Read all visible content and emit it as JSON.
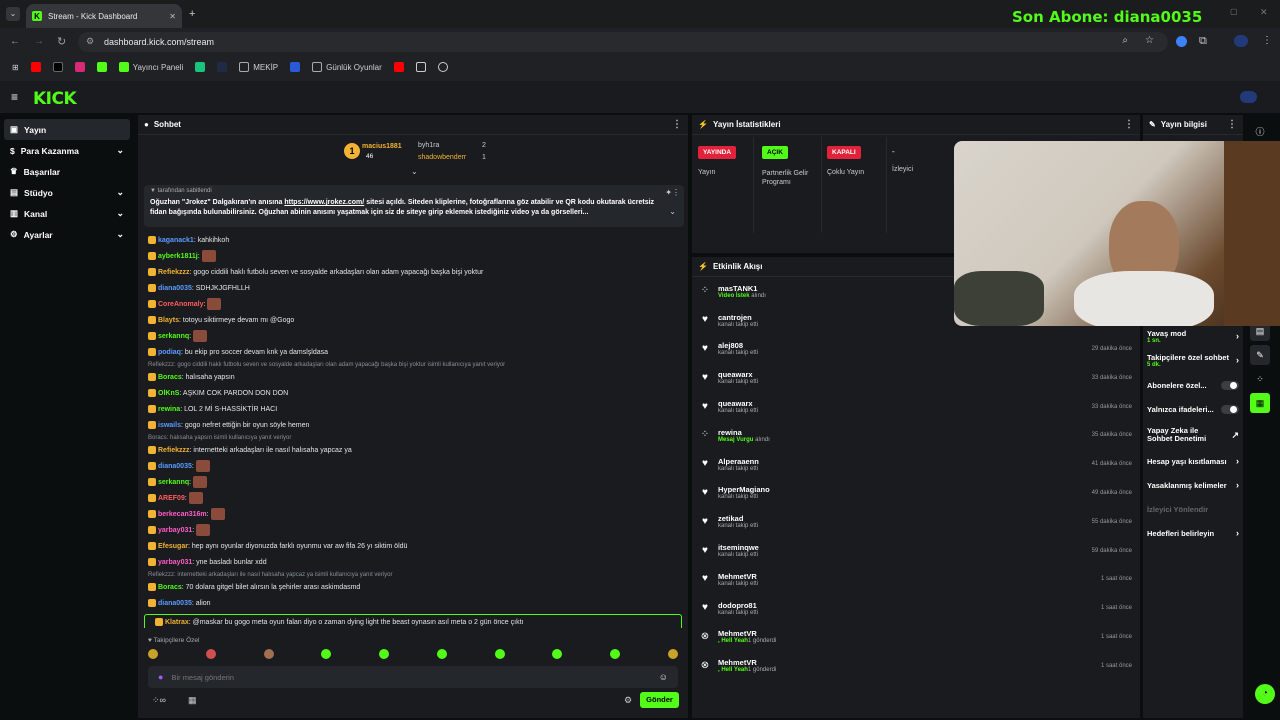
{
  "browser": {
    "tab_title": "Stream - Kick Dashboard",
    "url": "dashboard.kick.com/stream",
    "overlay_text": "Son Abone: diana0035",
    "bookmarks": [
      "Yayıncı Paneli",
      "MEKİP",
      "Günlük Oyunlar"
    ]
  },
  "sidebar": {
    "items": [
      {
        "label": "Yayın"
      },
      {
        "label": "Para Kazanma"
      },
      {
        "label": "Başarılar"
      },
      {
        "label": "Stüdyo"
      },
      {
        "label": "Kanal"
      },
      {
        "label": "Ayarlar"
      }
    ]
  },
  "chat": {
    "title": "Sohbet",
    "top_gifters": [
      {
        "name": "macius1881",
        "count": "46"
      },
      {
        "name": "byh1ra",
        "count": "2"
      },
      {
        "name": "shadowbenderr",
        "count": "1"
      }
    ],
    "pinned_by": "tarafından sabitlendi",
    "pinned_text_1": "Oğuzhan \"Jrokez\" Dalgakıran'ın anısına",
    "pinned_link": "https://www.jrokez.com/",
    "pinned_text_2": "sitesi açıldı. Siteden kliplerine, fotoğraflarına göz atabilir ve QR kodu okutarak ücretsiz fidan bağışında bulunabilirsiniz. Oğuzhan abinin anısını yaşatmak için siz de siteye girip eklemek istediğiniz video ya da görselleri...",
    "messages": [
      {
        "user": "kaganack1",
        "text": ": kahkihkoh",
        "color": "#5b9bff"
      },
      {
        "user": "ayberk1811j",
        "text": ":",
        "color": "#53fc18"
      },
      {
        "user": "Refiekzzz",
        "text": ": gogo ciddili haklı futbolu seven ve sosyalde arkadaşları olan adam yapacağı başka bişi yoktur",
        "color": "#f2b233"
      },
      {
        "user": "diana0035",
        "text": ": SDHJKJGFHLLH",
        "color": "#5b9bff"
      },
      {
        "user": "CoreAnomaly",
        "text": ":",
        "color": "#ff5c5c"
      },
      {
        "user": "Blayts",
        "text": ": totoyu siktirmeye devam mı @Gogo",
        "color": "#f2b233"
      },
      {
        "user": "serkannq",
        "text": ":",
        "color": "#53fc18"
      },
      {
        "user": "podiaq",
        "text": ": bu ekip pro soccer devam knk ya damslşldasa",
        "color": "#5b9bff"
      },
      {
        "reply": "Refiekzzz: gogo ciddili haklı futbolu seven ve sosyalde arkadaşları olan adam yapacağı başka bişi yoktur isimli kullanıcıya yanıt veriyor",
        "user": "Boracs",
        "text": ": halısaha yapsın",
        "color": "#53fc18"
      },
      {
        "user": "OlKnS",
        "text": ": AŞKIM COK PARDON DON DON",
        "color": "#53fc18"
      },
      {
        "user": "rewina",
        "text": ": LOL 2 Mİ S-HASSİKTİR HACI",
        "color": "#53fc18"
      },
      {
        "user": "iswails",
        "text": ": gogo nefret ettiğin bir oyun söyle hemen",
        "color": "#5b9bff"
      },
      {
        "reply": "Boracs: halısaha yapsın isimli kullanıcıya yanıt veriyor",
        "user": "Refiekzzz",
        "text": ": internetteki arkadaşları ile nasıl halısaha yapcaz ya",
        "color": "#f2b233"
      },
      {
        "user": "diana0035",
        "text": ":",
        "color": "#5b9bff"
      },
      {
        "user": "serkannq",
        "text": ":",
        "color": "#53fc18"
      },
      {
        "user": "AREF09",
        "text": ":",
        "color": "#ff5c5c"
      },
      {
        "user": "berkecan316m",
        "text": ":",
        "color": "#ff5cc8"
      },
      {
        "user": "yarbay031",
        "text": ":",
        "color": "#ff5cc8"
      },
      {
        "user": "Efesugar",
        "text": ": hep aynı oyunlar diyonuzda farklı oyunmu var aw fifa 26 yı siktim öldü",
        "color": "#f2b233"
      },
      {
        "user": "yarbay031",
        "text": ": yne basladı bunlar xdd",
        "color": "#ff5cc8"
      },
      {
        "reply": "Refiekzzz: internetteki arkadaşları ile nasıl halısaha yapcaz ya isimli kullanıcıya yanıt veriyor",
        "user": "Boracs",
        "text": ": 70 dolara gitgel bilet alırsın la şehirler arası askimdasmd",
        "color": "#53fc18"
      },
      {
        "user": "diana0035",
        "text": ": alion",
        "color": "#5b9bff"
      },
      {
        "user": "Klatrax",
        "text": ": @maskar bu gogo meta oyun falan diyo o zaman dying light the beast oynasın asıl meta o 2 gün önce çıktı",
        "color": "#f2b233"
      }
    ],
    "followers_only": "Takipçilere Özel",
    "input_placeholder": "Bir mesaj gönderin",
    "send_label": "Gönder"
  },
  "stats": {
    "title": "Yayın İstatistikleri",
    "items": [
      {
        "pill": "YAYINDA",
        "label": "Yayın",
        "color": "#e0223a"
      },
      {
        "pill": "AÇIK",
        "label": "Partnerlik Gelir Programı",
        "color": "#53fc18"
      },
      {
        "pill": "KAPALI",
        "label": "Çoklu Yayın",
        "color": "#e0223a"
      },
      {
        "pill": "-",
        "label": "İzleyici",
        "color": ""
      }
    ]
  },
  "events": {
    "title": "Etkinlik Akışı",
    "items": [
      {
        "name": "masTANK1",
        "sub_b": "Video İstek",
        "sub": " alındı",
        "time": ""
      },
      {
        "name": "cantrojen",
        "sub_b": "",
        "sub": "kanalı takip etti",
        "time": ""
      },
      {
        "name": "alej808",
        "sub_b": "",
        "sub": "kanalı takip etti",
        "time": "29 dakika önce"
      },
      {
        "name": "queawarx",
        "sub_b": "",
        "sub": "kanalı takip etti",
        "time": "33 dakika önce"
      },
      {
        "name": "queawarx",
        "sub_b": "",
        "sub": "kanalı takip etti",
        "time": "33 dakika önce"
      },
      {
        "name": "rewina",
        "sub_b": "Mesaj Vurgu",
        "sub": " alındı",
        "time": "35 dakika önce"
      },
      {
        "name": "Alperaaenn",
        "sub_b": "",
        "sub": "kanalı takip etti",
        "time": "41 dakika önce"
      },
      {
        "name": "HyperMagiano",
        "sub_b": "",
        "sub": "kanalı takip etti",
        "time": "49 dakika önce"
      },
      {
        "name": "zetikad",
        "sub_b": "",
        "sub": "kanalı takip etti",
        "time": "55 dakika önce"
      },
      {
        "name": "itseminqwe",
        "sub_b": "",
        "sub": "kanalı takip etti",
        "time": "59 dakika önce"
      },
      {
        "name": "MehmetVR",
        "sub_b": "",
        "sub": "kanalı takip etti",
        "time": "1 saat önce"
      },
      {
        "name": "dodopro81",
        "sub_b": "",
        "sub": "kanalı takip etti",
        "time": "1 saat önce"
      },
      {
        "name": "MehmetVR",
        "sub_b": ", Hell Yeah",
        "sub": "1 gönderdi",
        "time": "1 saat önce"
      },
      {
        "name": "MehmetVR",
        "sub_b": ", Hell Yeah",
        "sub": "1 gönderdi",
        "time": "1 saat önce"
      }
    ]
  },
  "info": {
    "title": "Yayın bilgisi",
    "slow_mode": "Yavaş mod",
    "slow_mode_val": "1 sn.",
    "followers_chat": "Takipçilere özel sohbet",
    "followers_chat_val": "5 dk.",
    "subs_only": "Abonelere özel...",
    "emotes_only": "Yalnızca ifadeleri...",
    "ai_moderation": "Yapay Zeka ile Sohbet Denetimi",
    "account_age": "Hesap yaşı kısıtlaması",
    "banned_words": "Yasaklanmış kelimeler",
    "viewer_redirect": "İzleyici Yönlendir",
    "goals": "Hedefleri belirleyin"
  },
  "colors": {
    "accent": "#53fc18",
    "live": "#e0223a",
    "panel": "#191b1f"
  }
}
